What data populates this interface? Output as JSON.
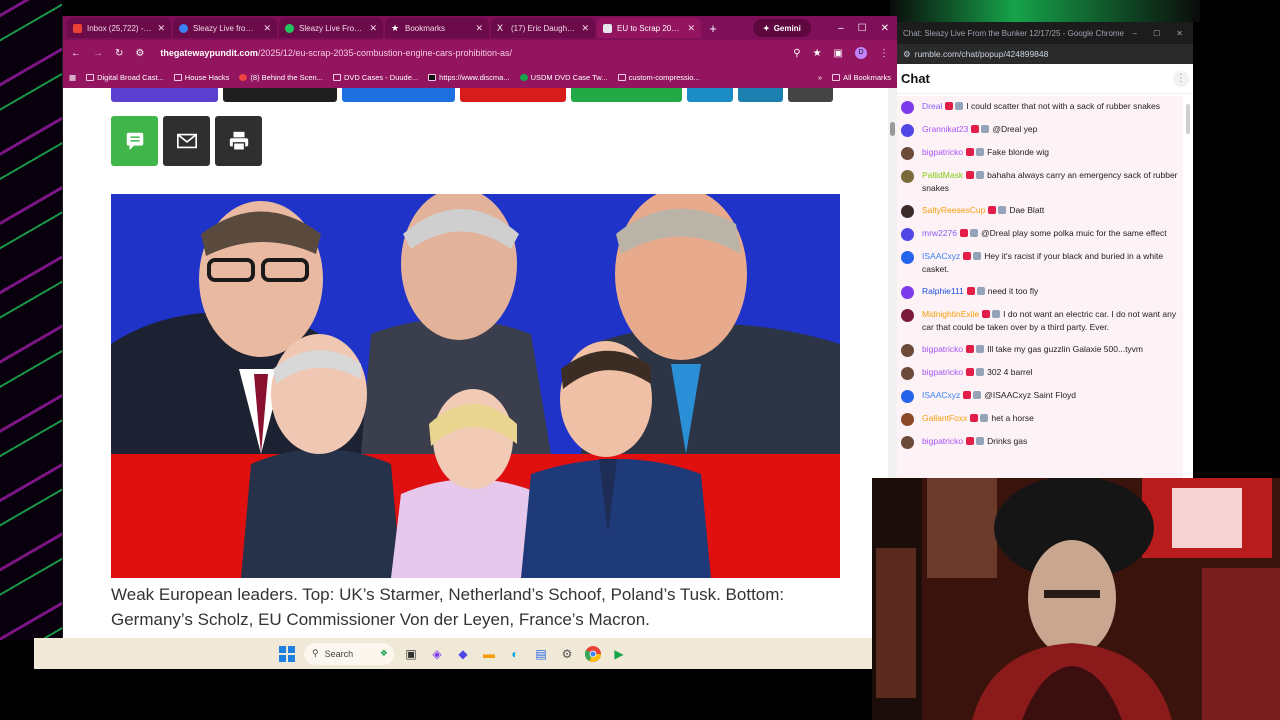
{
  "browser": {
    "tabs": [
      {
        "label": "Inbox (25,722) - hy",
        "color": "#ea4335"
      },
      {
        "label": "Sleazy Live from th",
        "color": "#3b82f6"
      },
      {
        "label": "Sleazy Live From th",
        "color": "#22c55e"
      },
      {
        "label": "Bookmarks",
        "color": "#f1f1f1"
      },
      {
        "label": "(17) Eric Daugherty",
        "color": "#111111"
      },
      {
        "label": "EU to Scrap 2035 C",
        "color": "#f1f1f1"
      }
    ],
    "new_tab": "+",
    "gemini_label": "Gemini",
    "window_controls": [
      "–",
      "☐",
      "✕"
    ],
    "url_host": "thegatewaypundit.com",
    "url_path": "/2025/12/eu-scrap-2035-combustion-engine-cars-prohibition-as/",
    "profile_initial": "D",
    "bookmarks": [
      "Digital Broad Cast...",
      "House Hacks",
      "(8) Behind the Scen...",
      "DVD Cases - Duude...",
      "https://www.discma...",
      "USDM DVD Case Tw...",
      "custom-compressio..."
    ],
    "bookmarks_more": "»",
    "all_bookmarks": "All Bookmarks"
  },
  "article": {
    "caption": "Weak European leaders. Top: UK’s Starmer, Netherland’s Schoof, Poland’s Tusk. Bottom: Germany’s Scholz, EU Commissioner Von der Leyen, France’s Macron.",
    "share_colors": [
      "#5b3fd1",
      "#1f1f1f",
      "#1e6fe0",
      "#d81b1b",
      "#22a845",
      "#1b8cc6",
      "#1b7fb0",
      "#444444"
    ],
    "sms_color": "#3fb54a",
    "email_color": "#2f2f2f",
    "print_color": "#2f2f2f"
  },
  "taskbar": {
    "search_placeholder": "Search",
    "background": "#f0e9d8"
  },
  "chat": {
    "window_title": "Chat: Sleazy Live From the Bunker 12/17/25 - Google Chrome",
    "window_controls": [
      "–",
      "☐",
      "✕"
    ],
    "url": "rumble.com/chat/popup/424899848",
    "title": "Chat",
    "messages": [
      {
        "user": "Dreal",
        "color": "#8b5cf6",
        "avatar": "#7c3aed",
        "text": "I could scatter that not with a sack of rubber snakes"
      },
      {
        "user": "Grannikat23",
        "color": "#a855f7",
        "avatar": "#4f46e5",
        "text": "@Dreal yep"
      },
      {
        "user": "bigpatricko",
        "color": "#a855f7",
        "avatar": "#6b4a3a",
        "text": "Fake blonde wig"
      },
      {
        "user": "PallidMask",
        "color": "#84cc16",
        "avatar": "#7a6a3a",
        "text": "bahaha always carry an emergency sack of rubber snakes"
      },
      {
        "user": "SaltyReesesCup",
        "color": "#f59e0b",
        "avatar": "#3a2a2a",
        "text": "Dae Blatt"
      },
      {
        "user": "mrw2276",
        "color": "#8b5cf6",
        "avatar": "#4f46e5",
        "text": "@Dreal play some polka muic for the same effect"
      },
      {
        "user": "ISAACxyz",
        "color": "#3b82f6",
        "avatar": "#2563eb",
        "text": "Hey it's racist if your black and buried in a white casket."
      },
      {
        "user": "Ralphie111",
        "color": "#1d4ed8",
        "avatar": "#7c3aed",
        "text": "need it too fly"
      },
      {
        "user": "MidnightinExile",
        "color": "#f59e0b",
        "avatar": "#7a1a3a",
        "text": "I do not want an electric car. I do not want any car that could be taken over by a third party. Ever."
      },
      {
        "user": "bigpatricko",
        "color": "#a855f7",
        "avatar": "#6b4a3a",
        "text": "Ill take my gas guzzlin Galaxie 500...tyvm"
      },
      {
        "user": "bigpatricko",
        "color": "#a855f7",
        "avatar": "#6b4a3a",
        "text": "302 4 barrel"
      },
      {
        "user": "ISAACxyz",
        "color": "#3b82f6",
        "avatar": "#2563eb",
        "text": "@ISAACxyz Saint Floyd"
      },
      {
        "user": "GallantFoxx",
        "color": "#f59e0b",
        "avatar": "#8a4a2a",
        "text": "het a horse"
      },
      {
        "user": "bigpatricko",
        "color": "#a855f7",
        "avatar": "#6b4a3a",
        "text": "Drinks gas"
      }
    ]
  }
}
